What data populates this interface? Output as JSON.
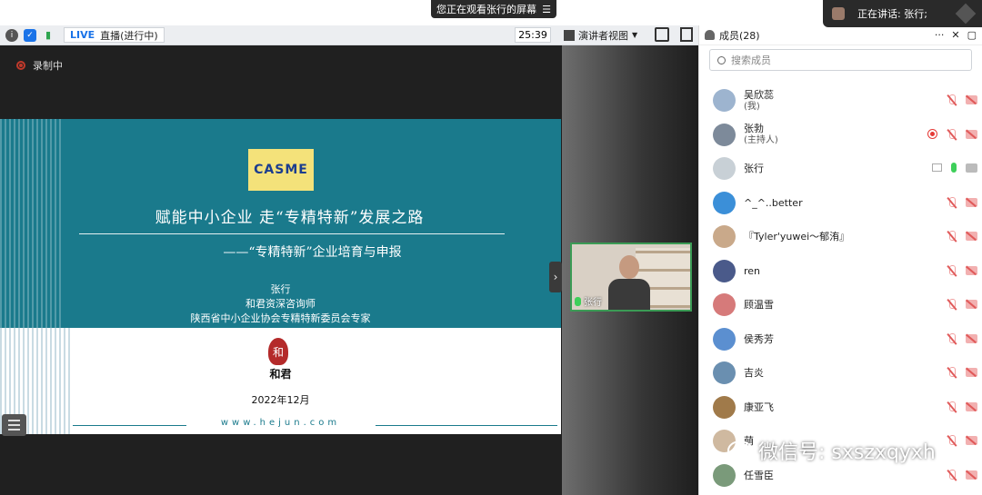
{
  "topbar": {
    "watching": "您正在观看张行的屏幕",
    "speaking": "正在讲话: 张行;"
  },
  "toolbar": {
    "live": "LIVE",
    "status": "直播(进行中)",
    "timer": "25:39",
    "view": "演讲者视图"
  },
  "recording": "录制中",
  "slide": {
    "logo": "CASME",
    "title": "赋能中小企业  走“专精特新”发展之路",
    "subtitle": "——“专精特新”企业培育与申报",
    "presenter": "张行",
    "role1": "和君资深咨询师",
    "role2": "陕西省中小企业协会专精特新委员会专家",
    "seal": "和",
    "brand": "和君",
    "date": "2022年12月",
    "url": "www.hejun.com"
  },
  "video": {
    "name": "张行"
  },
  "panel": {
    "title": "成员(28)",
    "search_placeholder": "搜索成员",
    "members": [
      {
        "name": "吴欣蕊",
        "sub": "(我)",
        "avatar": "#9db4cf",
        "status": "muted"
      },
      {
        "name": "张勃",
        "sub": "(主持人)",
        "avatar": "#7d8a9a",
        "status": "rec"
      },
      {
        "name": "张行",
        "sub": "",
        "avatar": "#c8d0d6",
        "status": "speaking"
      },
      {
        "name": "^_^..better",
        "sub": "",
        "avatar": "#3b8fd8",
        "status": "muted"
      },
      {
        "name": "『Tyler'yuwei～郁洧』",
        "sub": "",
        "avatar": "#c9a98a",
        "status": "muted"
      },
      {
        "name": "ren",
        "sub": "",
        "avatar": "#4a5a8a",
        "status": "muted"
      },
      {
        "name": "顾温雪",
        "sub": "",
        "avatar": "#d67a7a",
        "status": "muted"
      },
      {
        "name": "侯秀芳",
        "sub": "",
        "avatar": "#5b8fd0",
        "status": "muted"
      },
      {
        "name": "吉炎",
        "sub": "",
        "avatar": "#6a8fb0",
        "status": "muted"
      },
      {
        "name": "康亚飞",
        "sub": "",
        "avatar": "#a07a4a",
        "status": "muted"
      },
      {
        "name": "萌",
        "sub": "",
        "avatar": "#cfb9a0",
        "status": "muted"
      },
      {
        "name": "任雪臣",
        "sub": "",
        "avatar": "#7a9a7a",
        "status": "muted"
      }
    ]
  },
  "watermark": "微信号: sxszxqyxh"
}
